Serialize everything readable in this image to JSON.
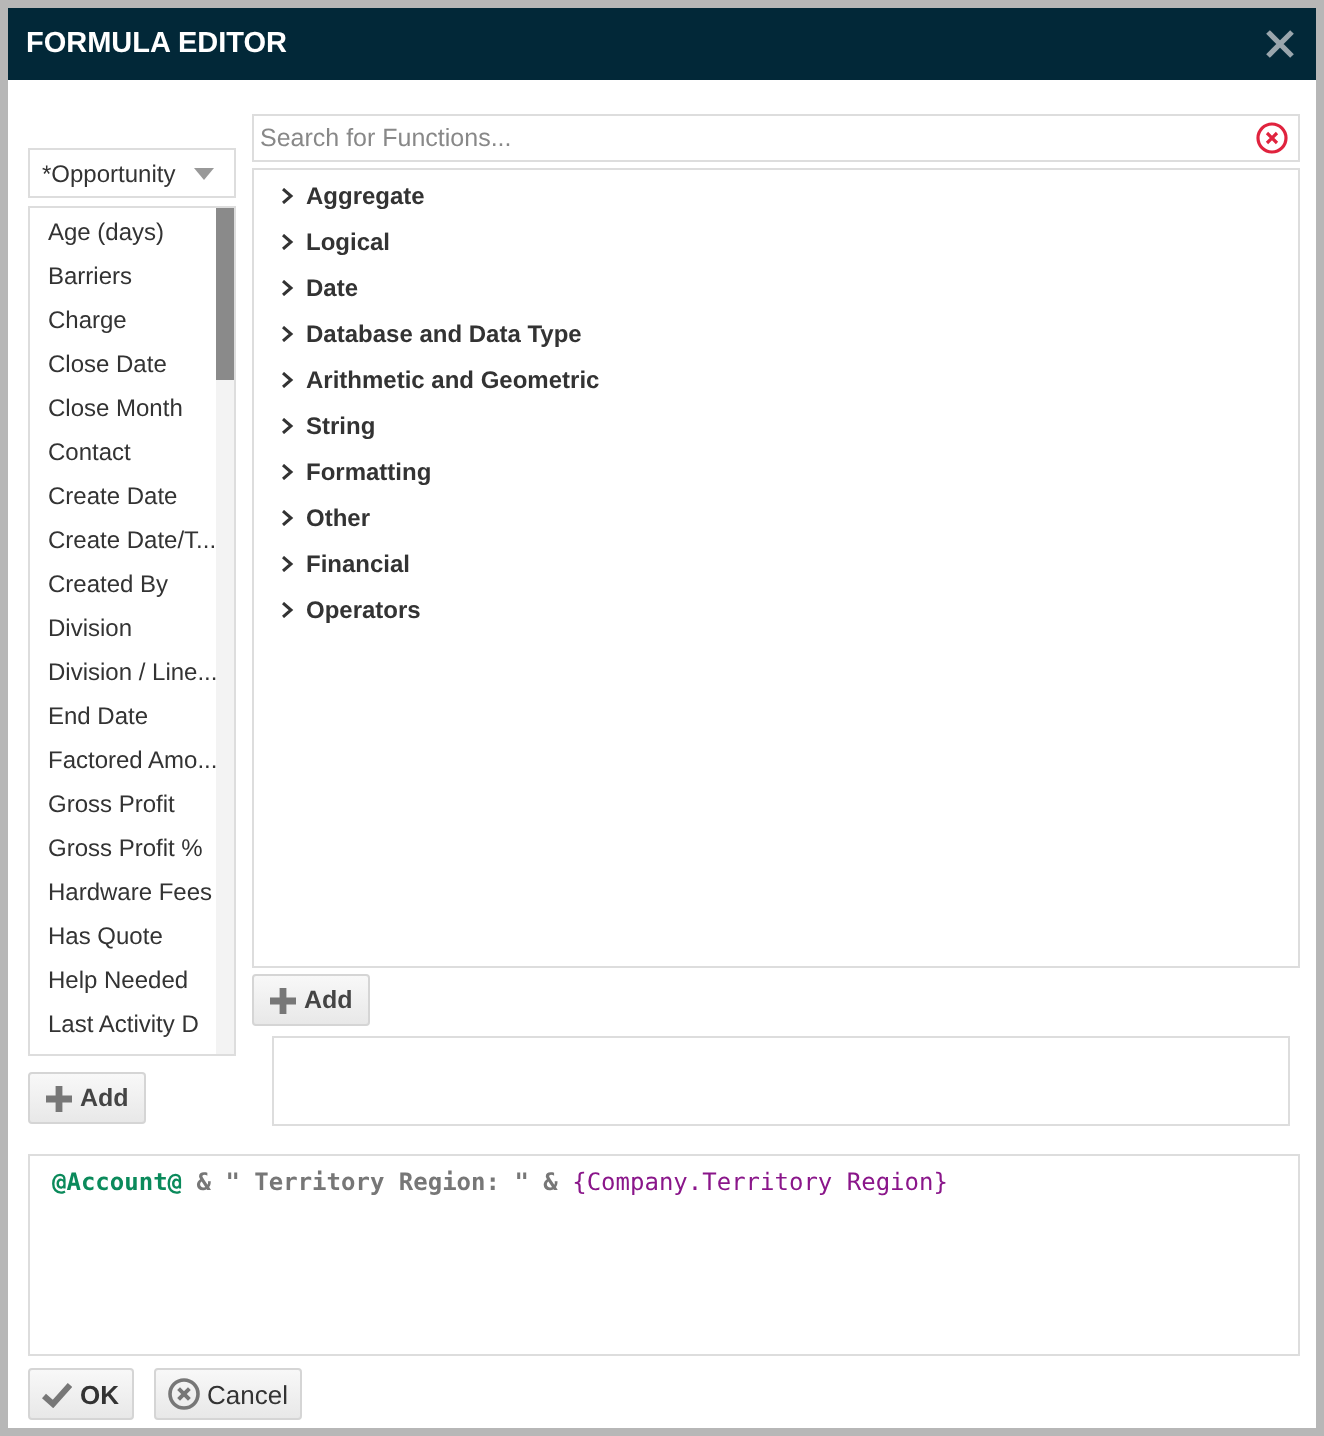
{
  "window": {
    "title": "FORMULA EDITOR"
  },
  "entity_select": {
    "value": "*Opportunity"
  },
  "fields": [
    {
      "label": "Age (days)"
    },
    {
      "label": "Barriers"
    },
    {
      "label": "Charge"
    },
    {
      "label": "Close Date"
    },
    {
      "label": "Close Month"
    },
    {
      "label": "Contact"
    },
    {
      "label": "Create Date"
    },
    {
      "label": "Create Date/T..."
    },
    {
      "label": "Created By"
    },
    {
      "label": "Division"
    },
    {
      "label": "Division / Line..."
    },
    {
      "label": "End Date"
    },
    {
      "label": "Factored Amo..."
    },
    {
      "label": "Gross Profit"
    },
    {
      "label": "Gross Profit %"
    },
    {
      "label": "Hardware Fees"
    },
    {
      "label": "Has Quote"
    },
    {
      "label": "Help Needed"
    },
    {
      "label": "Last Activity D"
    }
  ],
  "fields_add": "Add",
  "search": {
    "placeholder": "Search for Functions..."
  },
  "function_groups": [
    {
      "label": "Aggregate",
      "expanded": false
    },
    {
      "label": "Logical",
      "expanded": false
    },
    {
      "label": "Date",
      "expanded": false
    },
    {
      "label": "Database and Data Type",
      "expanded": false
    },
    {
      "label": "Arithmetic and Geometric",
      "expanded": false
    },
    {
      "label": "String",
      "expanded": false
    },
    {
      "label": "Formatting",
      "expanded": false
    },
    {
      "label": "Other",
      "expanded": false
    },
    {
      "label": "Financial",
      "expanded": false
    },
    {
      "label": "Operators",
      "expanded": false
    }
  ],
  "functions_add": "Add",
  "formula": [
    {
      "kind": "field",
      "text": "@Account@"
    },
    {
      "kind": "plain",
      "text": " & \" Territory Region: \" & "
    },
    {
      "kind": "merge",
      "text": "{Company.Territory Region}"
    }
  ],
  "buttons": [
    {
      "kind": "ok",
      "label": "OK"
    },
    {
      "kind": "cancel",
      "label": "Cancel"
    }
  ]
}
